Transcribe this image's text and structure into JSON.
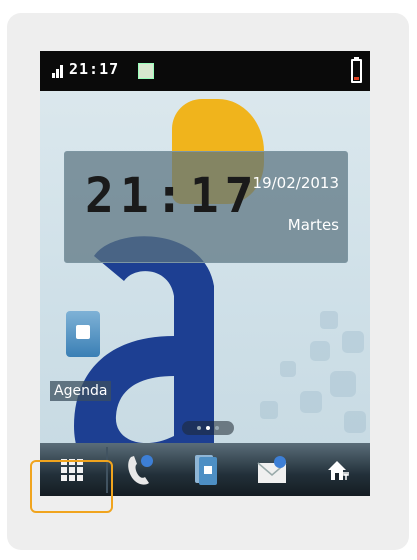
{
  "status_bar": {
    "time": "21:17",
    "icons": [
      "signal-icon",
      "notification-icon",
      "battery-icon"
    ]
  },
  "clock_widget": {
    "time": "21:17",
    "date": "19/02/2013",
    "day": "Martes"
  },
  "shortcuts": [
    {
      "label": "Agenda",
      "icon": "contacts-folder-icon"
    }
  ],
  "page_indicator": {
    "pages": 3,
    "current": 2
  },
  "dock": {
    "items": [
      {
        "name": "apps-grid-button",
        "icon": "grid-icon"
      },
      {
        "name": "phone-button",
        "icon": "phone-icon"
      },
      {
        "name": "contacts-button",
        "icon": "contacts-icon"
      },
      {
        "name": "messages-button",
        "icon": "envelope-icon"
      },
      {
        "name": "home-settings-button",
        "icon": "home-icon"
      }
    ],
    "focused": "apps-grid-button"
  },
  "colors": {
    "focus_ring": "#f0a41e",
    "accent_blue": "#1d3f92",
    "wallpaper_yellow": "#f0b41c"
  }
}
